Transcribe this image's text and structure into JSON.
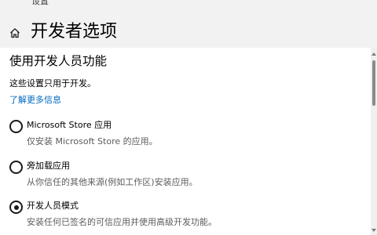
{
  "header": {
    "top_stub": "设置",
    "home_icon": "home-icon",
    "title": "开发者选项"
  },
  "section": {
    "title": "使用开发人员功能",
    "description": "这些设置只用于开发。",
    "learn_more": "了解更多信息"
  },
  "options": [
    {
      "label": "Microsoft Store 应用",
      "description": "仅安装 Microsoft Store 的应用。",
      "selected": false
    },
    {
      "label": "旁加载应用",
      "description": "从你信任的其他来源(例如工作区)安装应用。",
      "selected": false
    },
    {
      "label": "开发人员模式",
      "description": "安装任何已签名的可信应用并使用高级开发功能。",
      "selected": true
    }
  ],
  "colors": {
    "header_bg": "#f2f2f2",
    "link": "#0067c0",
    "secondary_text": "#5c5c5c",
    "radio": "#1a1a1a"
  }
}
